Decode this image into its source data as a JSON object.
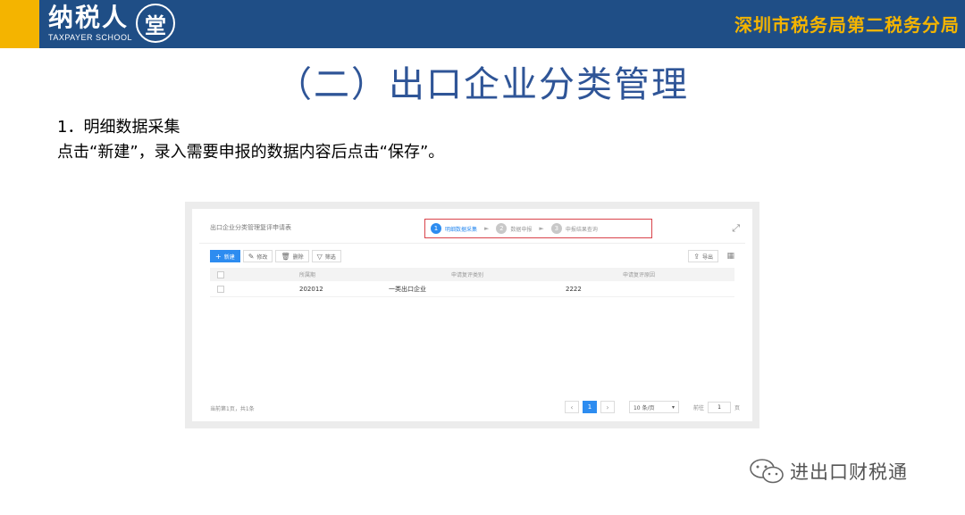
{
  "banner": {
    "logo_text": "纳税人",
    "logo_sub": "TAXPAYER SCHOOL",
    "logo_seal": "堂",
    "bureau": "深圳市税务局第二税务分局"
  },
  "slide": {
    "title": "（二）出口企业分类管理",
    "step_heading": "1．明细数据采集",
    "instruction": "点击“新建”，录入需要申报的数据内容后点击“保存”。"
  },
  "app": {
    "window_title": "出口企业分类管理复评申请表",
    "wizard_steps": [
      {
        "num": "1",
        "label": "明细数据采集",
        "active": true
      },
      {
        "num": "2",
        "label": "数据申报",
        "active": false
      },
      {
        "num": "3",
        "label": "申报结果查询",
        "active": false
      }
    ],
    "toolbar": {
      "new_label": "新建",
      "edit_label": "修改",
      "delete_label": "删除",
      "filter_label": "筛选",
      "export_label": "导出"
    },
    "table": {
      "columns": [
        "所属期",
        "申请复评类别",
        "申请复评原因"
      ],
      "rows": [
        {
          "period": "202012",
          "category": "一类出口企业",
          "reason": "2222"
        }
      ]
    },
    "pagination": {
      "summary": "当前第1页，共1条",
      "current_page": "1",
      "page_size": "10 条/页",
      "goto_label": "前往",
      "goto_value": "1",
      "page_suffix": "页"
    }
  },
  "watermark": {
    "text": "进出口财税通"
  }
}
